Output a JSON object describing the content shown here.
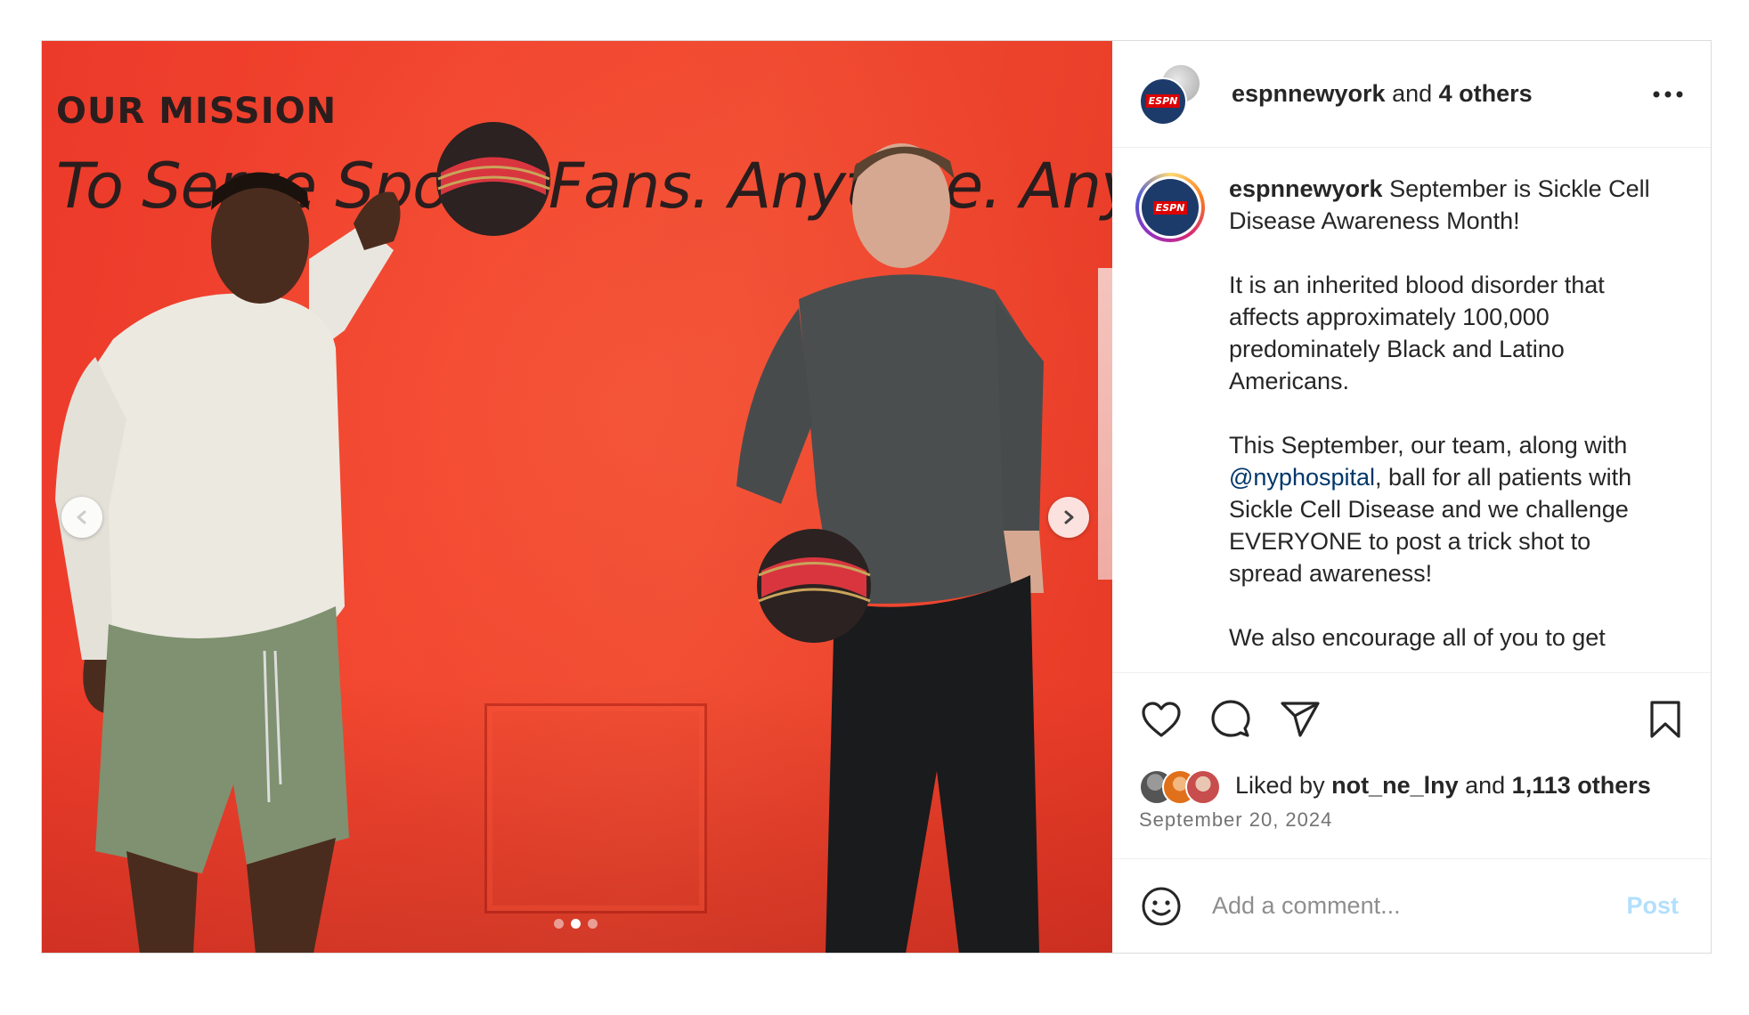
{
  "media": {
    "wall_heading": "OUR MISSION",
    "wall_text": "To Serve Sports Fans. Anytime. Anywhere.",
    "carousel": {
      "count": 3,
      "active_index": 1
    },
    "icons": {
      "prev": "chevron-left-icon",
      "next": "chevron-right-icon"
    }
  },
  "header": {
    "username": "espnnewyork",
    "joiner": " and ",
    "others": "4 others",
    "avatar_badge": "ESPN"
  },
  "caption": {
    "username": "espnnewyork",
    "p1": " September is Sickle Cell Disease Awareness Month!",
    "p2": "It is an inherited blood disorder that affects approximately 100,000 predominately Black and Latino Americans.",
    "p3_before": "This September, our team, along with ",
    "p3_mention": "@nyphospital",
    "p3_after": ", ball for all patients with Sickle Cell Disease and we challenge EVERYONE to post a trick shot to spread awareness!",
    "p4": "We also encourage all of you to get"
  },
  "actions": {
    "icons": [
      "heart-icon",
      "comment-icon",
      "share-icon",
      "bookmark-icon"
    ]
  },
  "likes": {
    "prefix": "Liked by ",
    "user": "not_ne_lny",
    "joiner": " and ",
    "others": "1,113 others"
  },
  "date": "September 20, 2024",
  "comment": {
    "placeholder": "Add a comment...",
    "post_label": "Post"
  },
  "colors": {
    "wall_red": "#ec3a2a",
    "mention_blue": "#00376b",
    "post_disabled": "#b2dffc",
    "muted_text": "#737373"
  }
}
